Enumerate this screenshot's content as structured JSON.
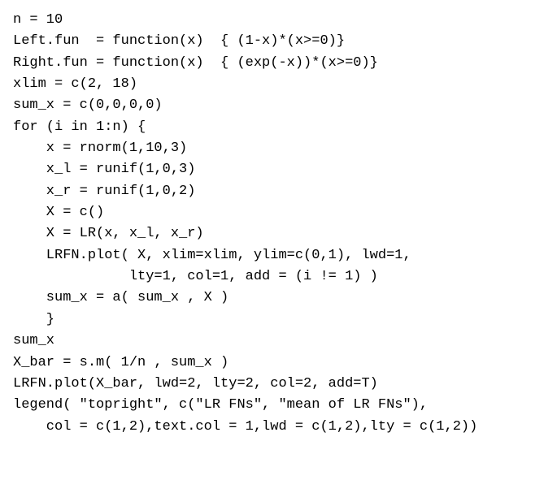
{
  "code": {
    "lines": [
      "n = 10",
      "Left.fun  = function(x)  { (1-x)*(x>=0)}",
      "Right.fun = function(x)  { (exp(-x))*(x>=0)}",
      "xlim = c(2, 18)",
      "sum_x = c(0,0,0,0)",
      "for (i in 1:n) {",
      "    x = rnorm(1,10,3)",
      "    x_l = runif(1,0,3)",
      "    x_r = runif(1,0,2)",
      "    X = c()",
      "    X = LR(x, x_l, x_r)",
      "    LRFN.plot( X, xlim=xlim, ylim=c(0,1), lwd=1,",
      "              lty=1, col=1, add = (i != 1) )",
      "    sum_x = a( sum_x , X )",
      "    }",
      "sum_x",
      "X_bar = s.m( 1/n , sum_x )",
      "LRFN.plot(X_bar, lwd=2, lty=2, col=2, add=T)",
      "legend( \"topright\", c(\"LR FNs\", \"mean of LR FNs\"),",
      "    col = c(1,2),text.col = 1,lwd = c(1,2),lty = c(1,2))"
    ]
  }
}
